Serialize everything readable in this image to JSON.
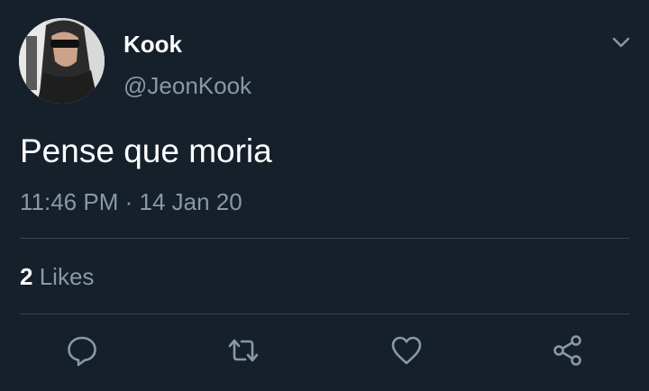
{
  "tweet": {
    "display_name": "Kook",
    "handle": "@JeonKook",
    "text": "Pense que moria",
    "time": "11:46 PM",
    "separator": "·",
    "date": "14 Jan 20",
    "likes_count": "2",
    "likes_label": "Likes"
  },
  "icons": {
    "caret": "chevron-down-icon",
    "reply": "reply-icon",
    "retweet": "retweet-icon",
    "like": "heart-icon",
    "share": "share-icon"
  },
  "colors": {
    "background": "#15202b",
    "secondary_text": "#8899a6",
    "divider": "#38444d",
    "primary_text": "#ffffff"
  }
}
